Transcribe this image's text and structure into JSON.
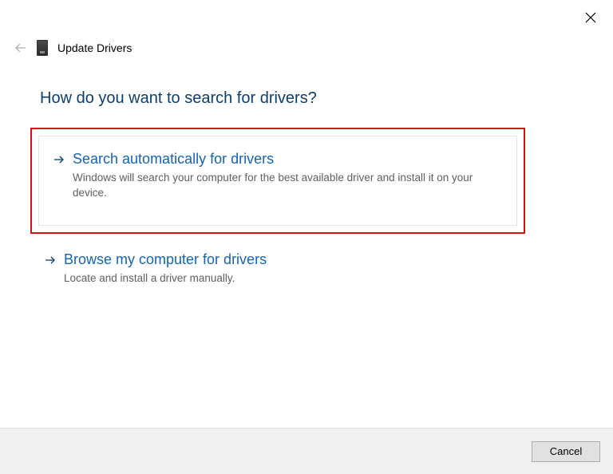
{
  "window": {
    "title": "Update Drivers"
  },
  "heading": "How do you want to search for drivers?",
  "options": [
    {
      "title": "Search automatically for drivers",
      "description": "Windows will search your computer for the best available driver and install it on your device."
    },
    {
      "title": "Browse my computer for drivers",
      "description": "Locate and install a driver manually."
    }
  ],
  "footer": {
    "cancel_label": "Cancel"
  }
}
